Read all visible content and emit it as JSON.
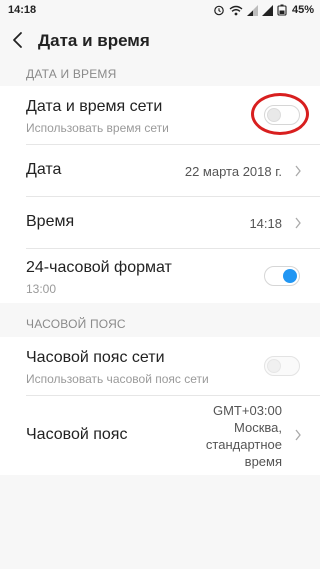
{
  "status_bar": {
    "time": "14:18",
    "battery": "45%",
    "icons": [
      "alarm-icon",
      "wifi-icon",
      "signal-icon",
      "signal-icon",
      "battery-icon"
    ]
  },
  "header": {
    "title": "Дата и время",
    "back_icon": "chevron-left-icon"
  },
  "sections": {
    "date_time": {
      "header": "ДАТА И ВРЕМЯ",
      "network_time": {
        "label": "Дата и время сети",
        "sub": "Использовать время сети",
        "enabled": false
      },
      "date": {
        "label": "Дата",
        "value": "22 марта 2018 г."
      },
      "time": {
        "label": "Время",
        "value": "14:18"
      },
      "format24": {
        "label": "24-часовой формат",
        "sub": "13:00",
        "enabled": true
      }
    },
    "timezone": {
      "header": "ЧАСОВОЙ ПОЯС",
      "network_tz": {
        "label": "Часовой пояс сети",
        "sub": "Использовать часовой пояс сети",
        "enabled": false
      },
      "tz": {
        "label": "Часовой пояс",
        "value_line1": "GMT+03:00",
        "value_line2": "Москва,",
        "value_line3": "стандартное",
        "value_line4": "время"
      }
    }
  },
  "colors": {
    "accent": "#2196f3",
    "annotation": "#d81f1f",
    "background": "#f7f7f7"
  }
}
